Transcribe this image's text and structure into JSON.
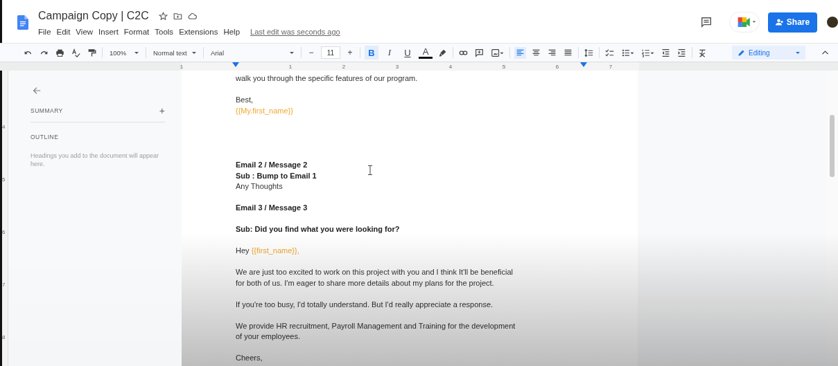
{
  "document": {
    "title": "Campaign Copy | C2C",
    "last_edit": "Last edit was seconds ago"
  },
  "menu": [
    "File",
    "Edit",
    "View",
    "Insert",
    "Format",
    "Tools",
    "Extensions",
    "Help"
  ],
  "header_actions": {
    "share": "Share"
  },
  "toolbar": {
    "zoom": "100%",
    "style": "Normal text",
    "font": "Arial",
    "font_size": "11",
    "minus": "−",
    "plus": "+",
    "format": [
      {
        "label": "B",
        "kind": "bold",
        "selected": true
      },
      {
        "label": "I",
        "kind": "italic",
        "selected": false
      },
      {
        "label": "U",
        "kind": "underline",
        "selected": false
      },
      {
        "label": "A",
        "kind": "color",
        "selected": false
      }
    ],
    "alignment": [
      {
        "kind": "left",
        "selected": true
      },
      {
        "kind": "center",
        "selected": false
      },
      {
        "kind": "right",
        "selected": false
      },
      {
        "kind": "justify",
        "selected": false
      }
    ],
    "mode": "Editing"
  },
  "ruler": {
    "marks": [
      "1",
      "1",
      "2",
      "3",
      "4",
      "5",
      "6",
      "7"
    ],
    "side_marks": [
      "4",
      "5",
      "6",
      "7",
      "8"
    ]
  },
  "sidebar": {
    "summary": "SUMMARY",
    "add": "+",
    "outline": "OUTLINE",
    "hint": "Headings you add to the document will appear here."
  },
  "blocks": [
    {
      "kind": "paragraph",
      "lines": [
        [
          {
            "text": "walk you through the specific features of our program."
          }
        ]
      ]
    },
    {
      "kind": "signature",
      "lines": [
        [
          {
            "text": "Best,"
          }
        ],
        [
          {
            "text": "{{My.first_name}}",
            "variable": true
          }
        ]
      ]
    },
    {
      "kind": "paragraph",
      "lines": [
        [
          {
            "text": "Email 2 / Message 2",
            "bold": true
          }
        ],
        [
          {
            "text": "Sub : Bump to Email 1",
            "bold": true
          }
        ],
        [
          {
            "text": "Any Thoughts"
          }
        ]
      ]
    },
    {
      "kind": "paragraph",
      "lines": [
        [
          {
            "text": "Email 3 / Message 3",
            "bold": true
          }
        ]
      ]
    },
    {
      "kind": "paragraph",
      "lines": [
        [
          {
            "text": "Sub: Did you find what you were looking for?",
            "bold": true
          }
        ]
      ]
    },
    {
      "kind": "paragraph",
      "lines": [
        [
          {
            "text": "Hey "
          },
          {
            "text": "{{first_name}},",
            "variable": true
          }
        ]
      ]
    },
    {
      "kind": "paragraph",
      "lines": [
        [
          {
            "text": "We are just too excited to work on this project with you and I think It'll be beneficial for both of us. I'm eager to share more details about my plans for the project."
          }
        ]
      ]
    },
    {
      "kind": "paragraph",
      "lines": [
        [
          {
            "text": "If you're too busy, I'd totally understand. But I'd really appreciate a response."
          }
        ]
      ]
    },
    {
      "kind": "paragraph",
      "lines": [
        [
          {
            "text": "We provide HR recruitment, Payroll Management and Training for the development of your employees."
          }
        ]
      ]
    },
    {
      "kind": "paragraph",
      "lines": [
        [
          {
            "text": "Cheers,"
          }
        ]
      ]
    }
  ]
}
